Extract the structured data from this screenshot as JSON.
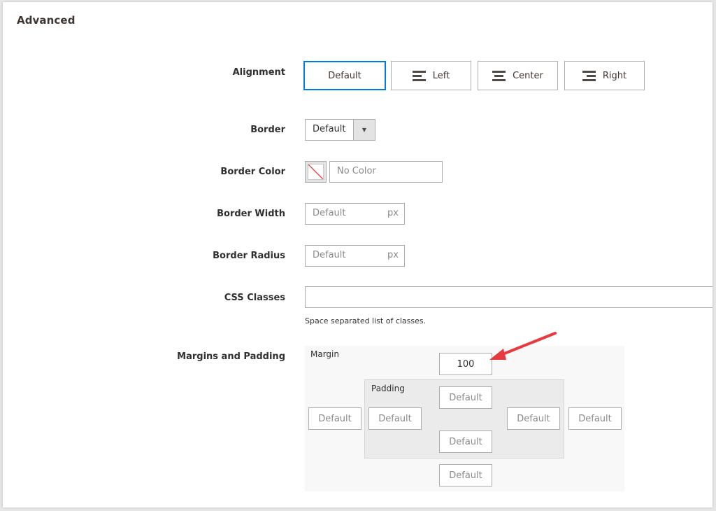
{
  "section": {
    "title": "Advanced"
  },
  "alignment": {
    "label": "Alignment",
    "options": [
      {
        "label": "Default",
        "icon": "none",
        "selected": true
      },
      {
        "label": "Left",
        "icon": "align-left-icon",
        "selected": false
      },
      {
        "label": "Center",
        "icon": "align-center-icon",
        "selected": false
      },
      {
        "label": "Right",
        "icon": "align-right-icon",
        "selected": false
      }
    ]
  },
  "border": {
    "label": "Border",
    "value": "Default"
  },
  "border_color": {
    "label": "Border Color",
    "placeholder": "No Color"
  },
  "border_width": {
    "label": "Border Width",
    "placeholder": "Default",
    "unit": "px"
  },
  "border_radius": {
    "label": "Border Radius",
    "placeholder": "Default",
    "unit": "px"
  },
  "css_classes": {
    "label": "CSS Classes",
    "value": "",
    "note": "Space separated list of classes."
  },
  "margins_padding": {
    "label": "Margins and Padding",
    "margin_label": "Margin",
    "padding_label": "Padding",
    "margin": {
      "top": "100",
      "right": "Default",
      "bottom": "Default",
      "left": "Default"
    },
    "padding": {
      "top": "Default",
      "right": "Default",
      "bottom": "Default",
      "left": "Default"
    }
  },
  "colors": {
    "accent": "#007bdb",
    "annotation_arrow": "#e8393f"
  }
}
